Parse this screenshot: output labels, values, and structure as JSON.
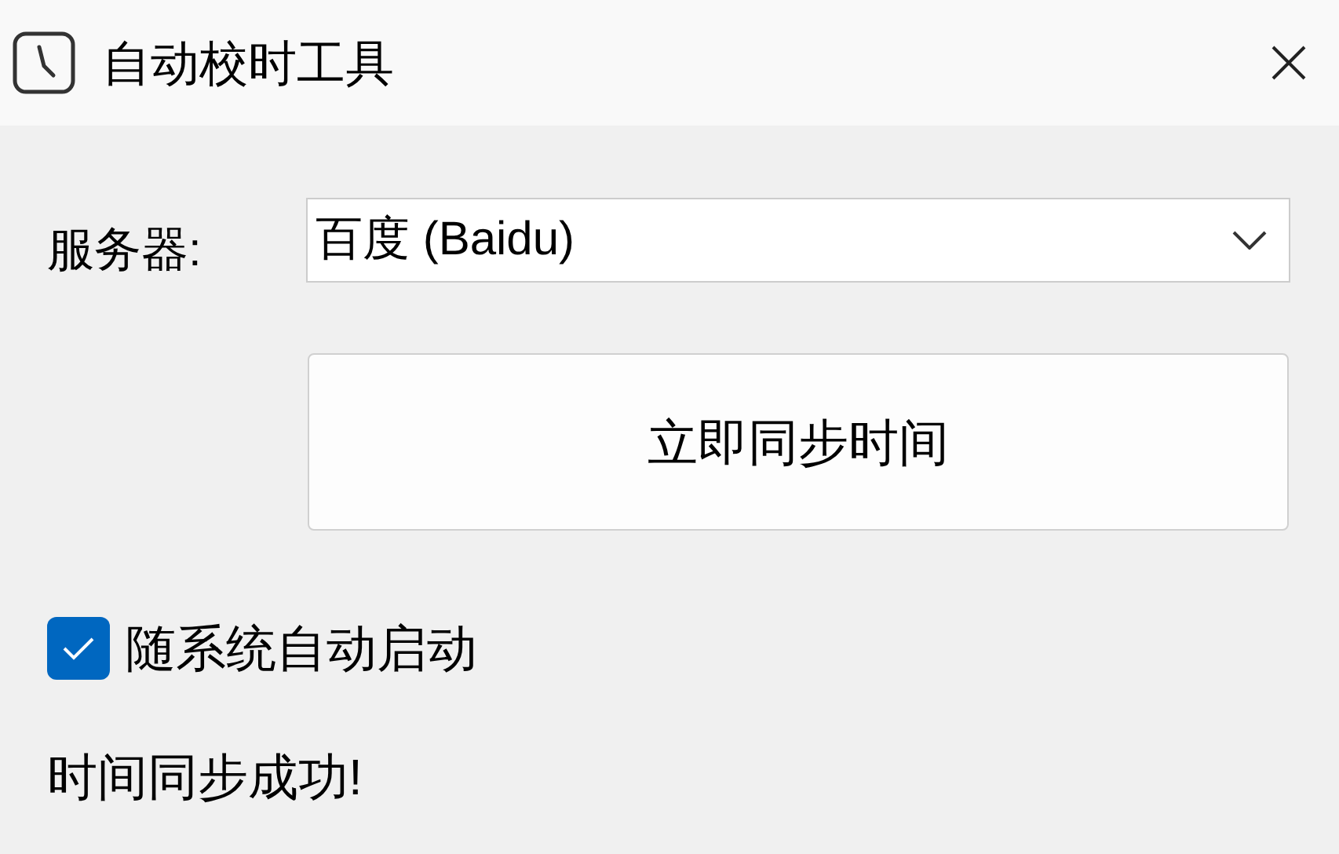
{
  "window": {
    "title": "自动校时工具"
  },
  "server": {
    "label": "服务器:",
    "value": "百度 (Baidu)"
  },
  "sync_button": {
    "label": "立即同步时间"
  },
  "autostart": {
    "label": "随系统自动启动",
    "checked": true
  },
  "status": "时间同步成功!"
}
